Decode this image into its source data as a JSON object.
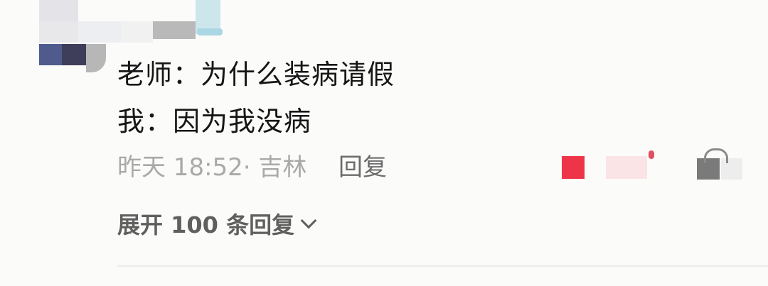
{
  "comment": {
    "line1": "老师：为什么装病请假",
    "line2": "我：因为我没病",
    "meta": "昨天 18:52· 吉林",
    "reply_label": "回复"
  },
  "replies": {
    "expand_label": "展开 100 条回复"
  },
  "icons": {
    "avatar": "avatar-pixelated",
    "like": "like-icon-pixelated",
    "dislike": "dislike-icon-pixelated",
    "expand": "chevron-down-icon"
  }
}
